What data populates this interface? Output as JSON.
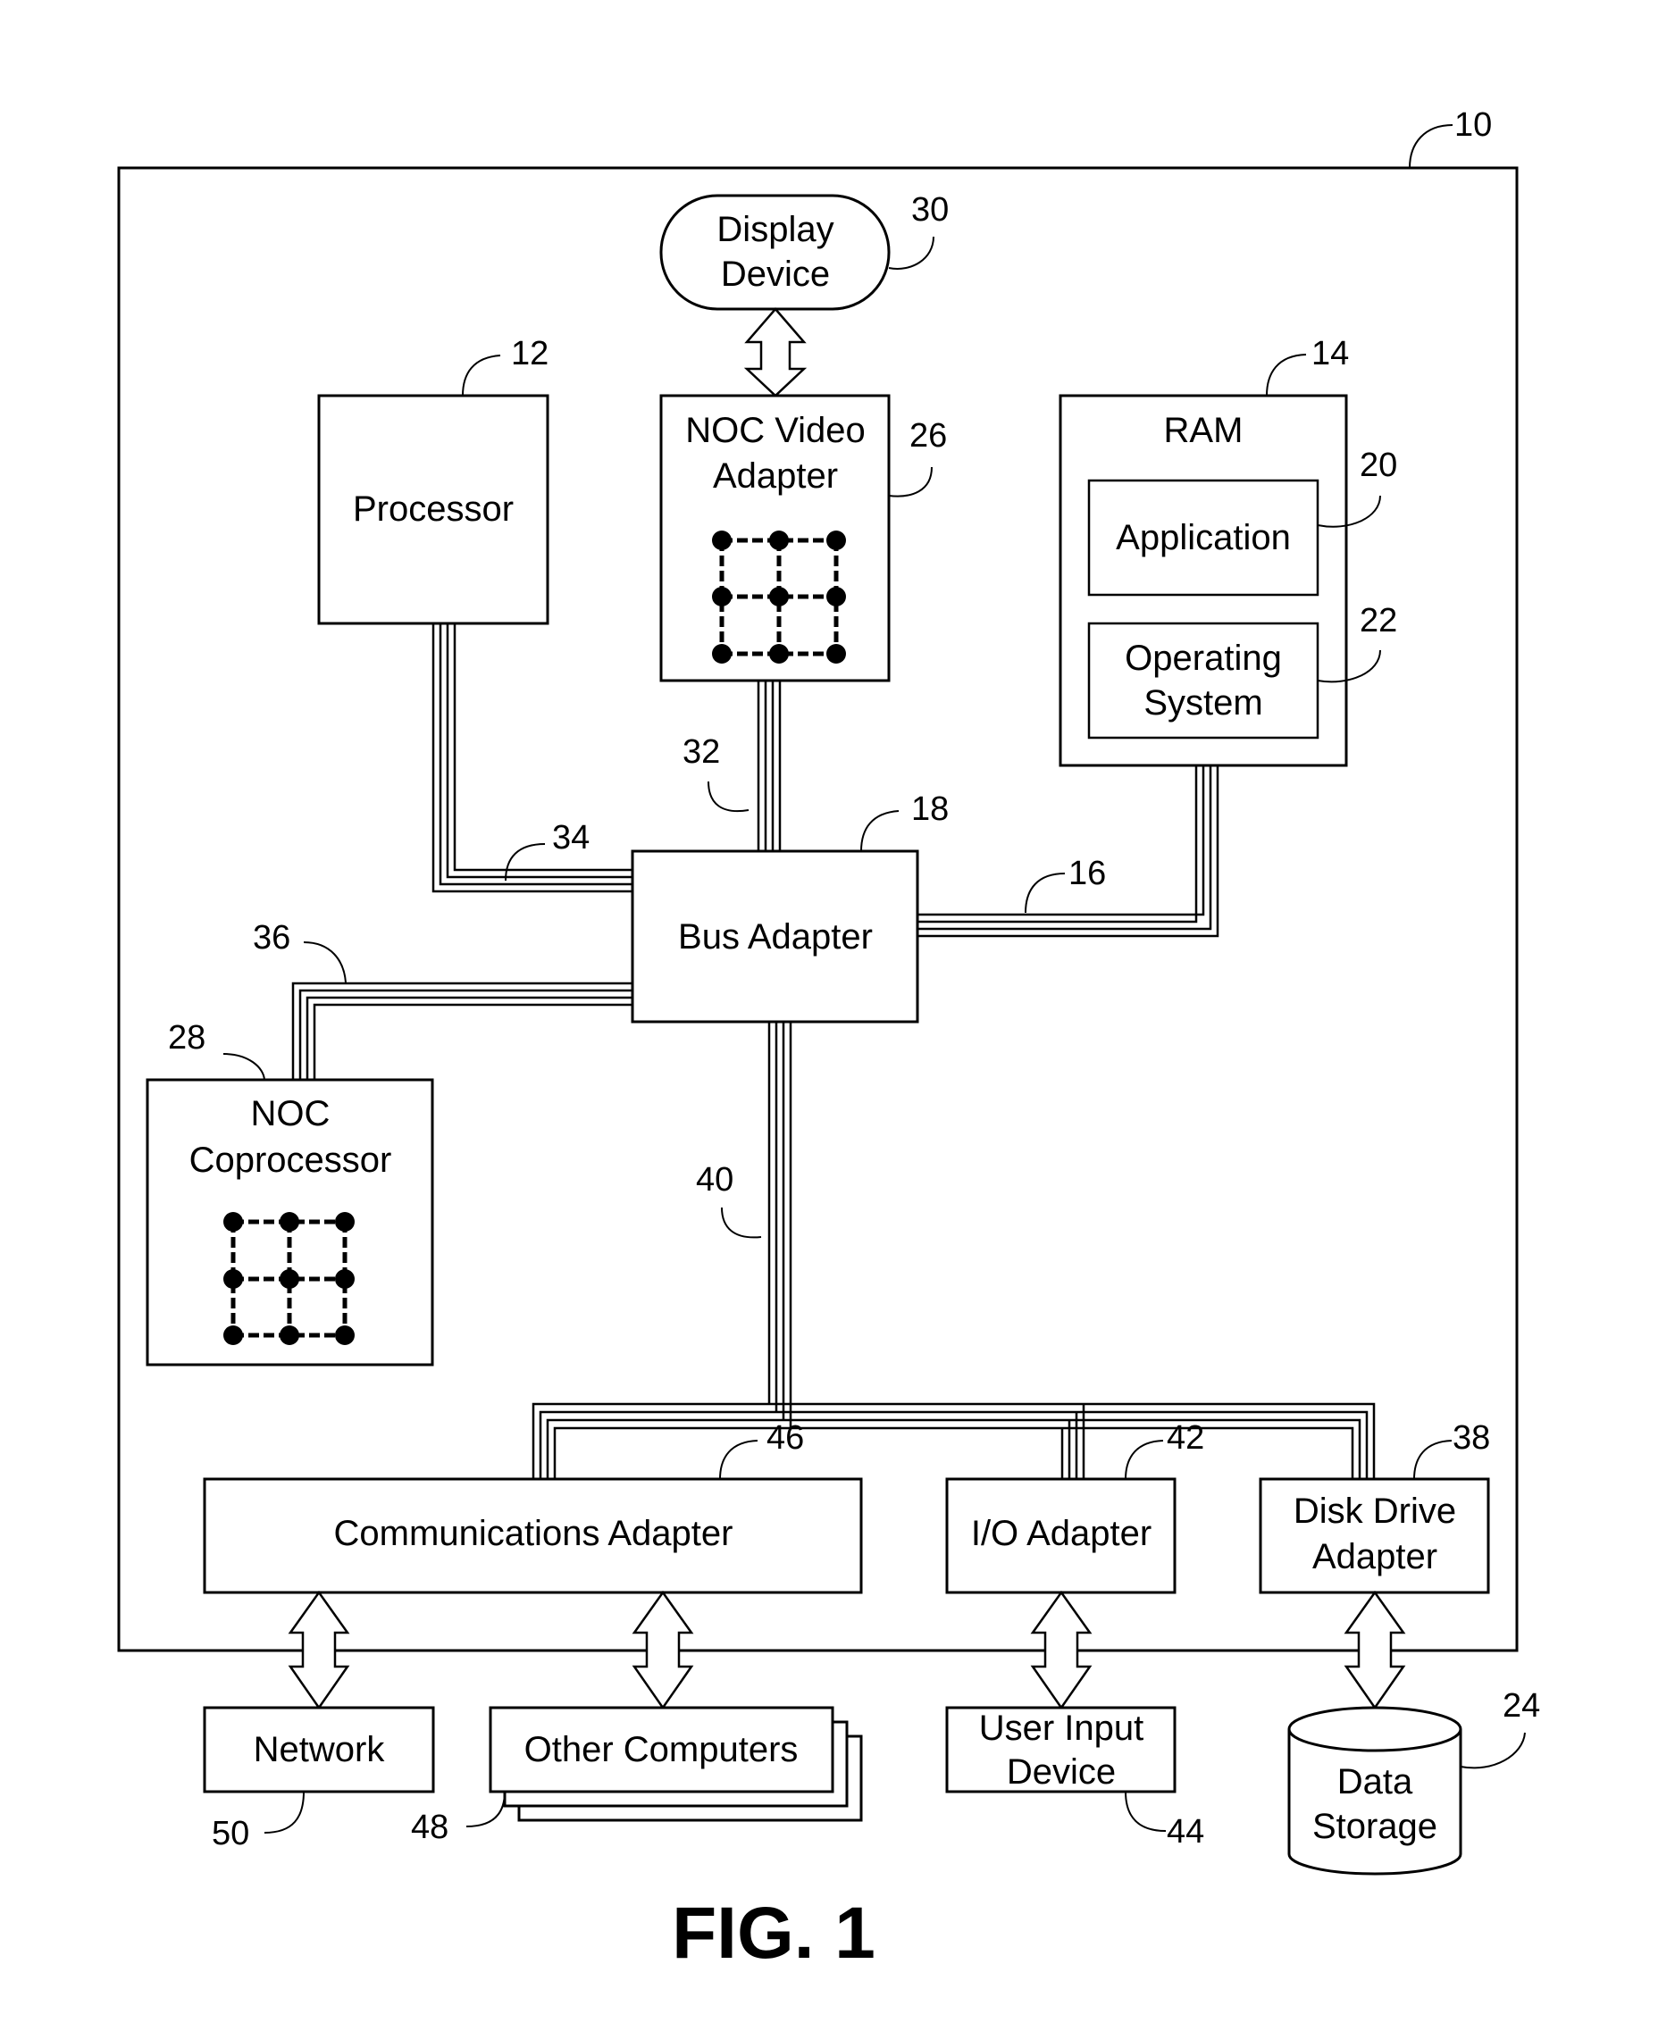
{
  "figure": {
    "label": "FIG. 1",
    "system_ref": "10"
  },
  "blocks": {
    "display_device": {
      "line1": "Display",
      "line2": "Device",
      "ref": "30"
    },
    "processor": {
      "label": "Processor",
      "ref": "12"
    },
    "noc_video_adapter": {
      "line1": "NOC Video",
      "line2": "Adapter",
      "ref": "26"
    },
    "ram": {
      "label": "RAM",
      "ref": "14"
    },
    "application": {
      "label": "Application",
      "ref": "20"
    },
    "operating_system": {
      "line1": "Operating",
      "line2": "System",
      "ref": "22"
    },
    "bus_adapter": {
      "label": "Bus Adapter",
      "ref": "18"
    },
    "noc_coprocessor": {
      "line1": "NOC",
      "line2": "Coprocessor",
      "ref": "28"
    },
    "communications_adapter": {
      "label": "Communications Adapter",
      "ref": "46"
    },
    "io_adapter": {
      "label": "I/O Adapter",
      "ref": "42"
    },
    "disk_drive_adapter": {
      "line1": "Disk Drive",
      "line2": "Adapter",
      "ref": "38"
    },
    "network": {
      "label": "Network",
      "ref": "50"
    },
    "other_computers": {
      "label": "Other Computers",
      "ref": "48"
    },
    "user_input_device": {
      "line1": "User Input",
      "line2": "Device",
      "ref": "44"
    },
    "data_storage": {
      "line1": "Data",
      "line2": "Storage",
      "ref": "24"
    }
  },
  "buses": {
    "video_bus": {
      "ref": "32"
    },
    "front_side_bus": {
      "ref": "34"
    },
    "memory_bus": {
      "ref": "16"
    },
    "coprocessor_bus": {
      "ref": "36"
    },
    "expansion_bus": {
      "ref": "40"
    }
  }
}
